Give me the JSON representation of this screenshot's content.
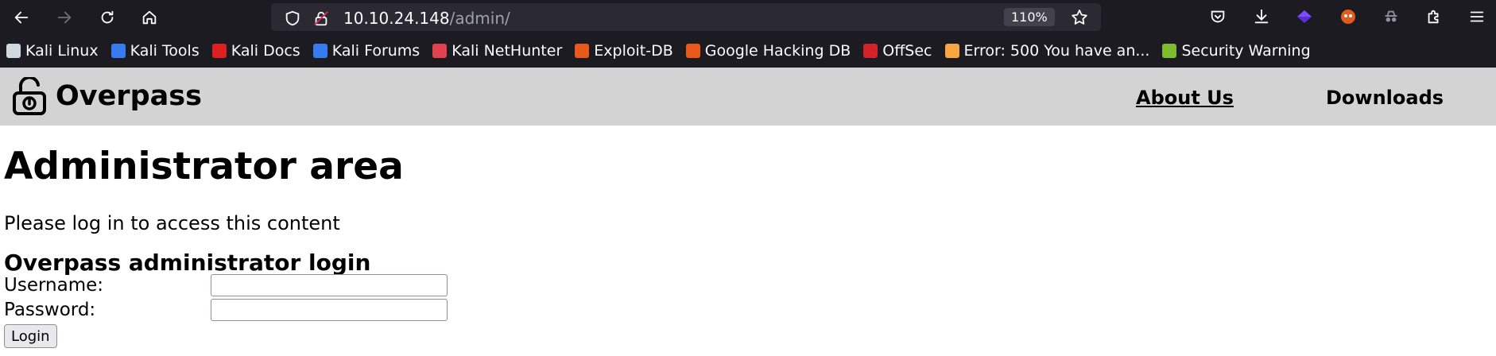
{
  "browser": {
    "url_host": "10.10.24.148",
    "url_path": "/admin/",
    "zoom": "110%",
    "bookmarks": [
      {
        "label": "Kali Linux",
        "icon": "kali-dragon-icon",
        "color": "#cfd8e3"
      },
      {
        "label": "Kali Tools",
        "icon": "kali-tools-icon",
        "color": "#367bf0"
      },
      {
        "label": "Kali Docs",
        "icon": "kali-docs-icon",
        "color": "#e02020"
      },
      {
        "label": "Kali Forums",
        "icon": "kali-forums-icon",
        "color": "#367bf0"
      },
      {
        "label": "Kali NetHunter",
        "icon": "nethunter-icon",
        "color": "#e0434f"
      },
      {
        "label": "Exploit-DB",
        "icon": "exploit-db-icon",
        "color": "#e8591a"
      },
      {
        "label": "Google Hacking DB",
        "icon": "ghdb-icon",
        "color": "#e8591a"
      },
      {
        "label": "OffSec",
        "icon": "offsec-icon",
        "color": "#d2232a"
      },
      {
        "label": "Error: 500 You have an...",
        "icon": "joomla-icon",
        "color": "#f9a541"
      },
      {
        "label": "Security Warning",
        "icon": "security-warning-icon",
        "color": "#7dbb2f"
      }
    ]
  },
  "site": {
    "name": "Overpass",
    "nav": {
      "about": "About Us",
      "downloads": "Downloads"
    }
  },
  "main": {
    "title": "Administrator area",
    "intro": "Please log in to access this content",
    "form_title": "Overpass administrator login",
    "username_label": "Username:",
    "password_label": "Password:",
    "username_value": "",
    "password_value": "",
    "login_label": "Login"
  },
  "colors": {
    "chrome_bg": "#1c1b22",
    "urlbar_bg": "#2b2a33",
    "header_bg": "#d3d3d3"
  }
}
